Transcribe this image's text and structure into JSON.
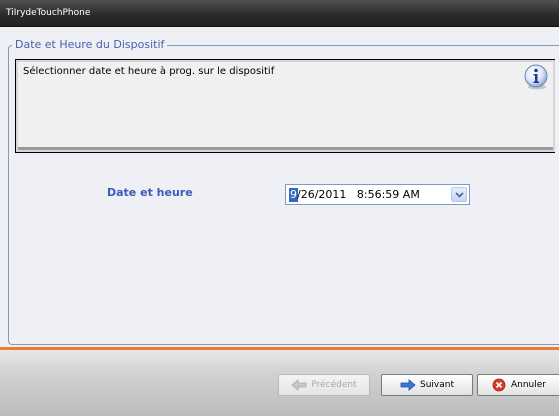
{
  "window": {
    "title": "TiIrydeTouchPhone"
  },
  "group": {
    "legend": "Date et Heure du Dispositif"
  },
  "info": {
    "message": "Sélectionner date et heure à prog. sur le dispositif",
    "icon": "info-icon"
  },
  "datetime": {
    "label": "Date et heure",
    "selected_part": "9",
    "rest": "/26/2011   8:56:59 AM"
  },
  "buttons": {
    "previous": "Précédent",
    "next": "Suivant",
    "cancel": "Annuler"
  },
  "colors": {
    "accent_line": "#f07c30",
    "label_blue": "#3c5ab6",
    "title_bar": "#2a2a2a"
  }
}
